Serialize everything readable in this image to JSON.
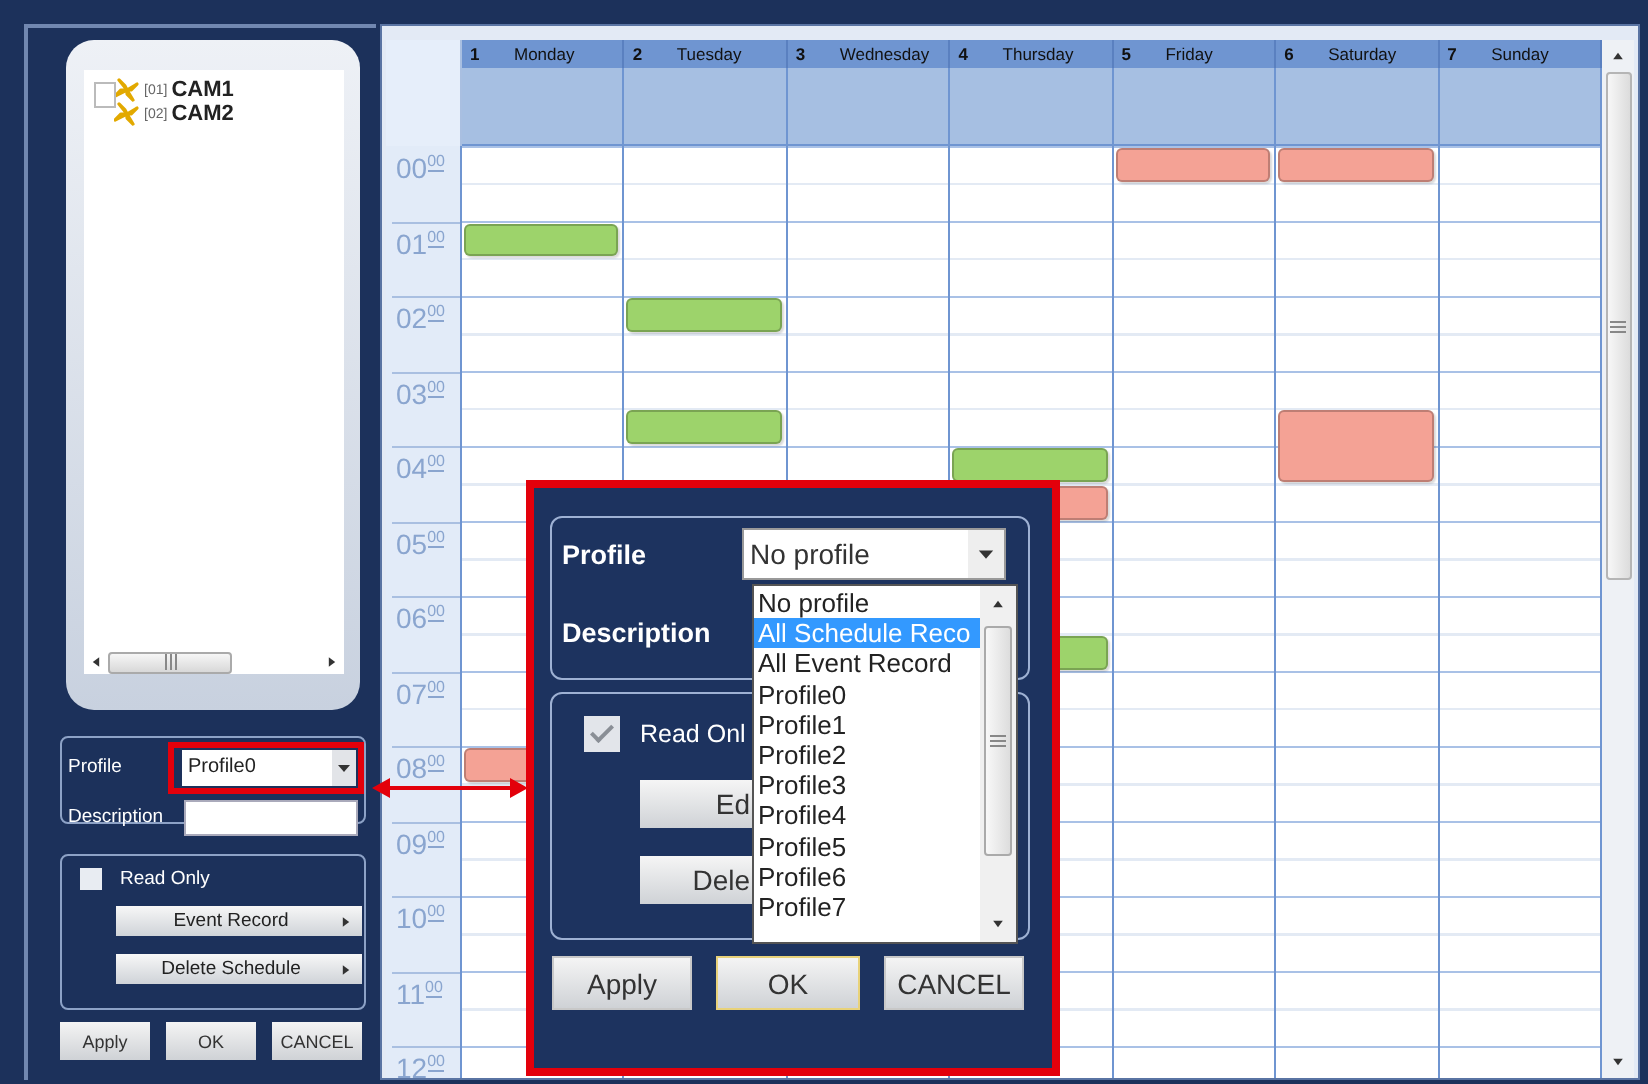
{
  "left_panel": {
    "cameras": {
      "checked": false,
      "items": [
        {
          "number": "[01]",
          "name": "CAM1"
        },
        {
          "number": "[02]",
          "name": "CAM2"
        }
      ]
    },
    "profile_label": "Profile",
    "profile_value": "Profile0",
    "description_label": "Description",
    "read_only": {
      "label": "Read Only",
      "checked": false
    },
    "menu_buttons": [
      "Event Record",
      "Delete Schedule"
    ],
    "buttons": [
      "Apply",
      "OK",
      "CANCEL"
    ]
  },
  "calendar": {
    "hours": [
      "00$^{00}$",
      "01$^{00}$",
      "02$^{00}$",
      "03$^{00}$",
      "04$^{00}$",
      "05$^{00}$",
      "06$^{00}$",
      "07$^{00}$",
      "08$^{00}$",
      "09$^{00}$",
      "10$^{00}$",
      "11$^{00}$",
      "12$^{00}$"
    ],
    "days": [
      {
        "number": "1",
        "name": "Monday",
        "slots": [
          {
            "kind": "empty"
          },
          {
            "kind": "empty"
          },
          {
            "kind": "block",
            "color": "#9dd36b"
          },
          {
            "kind": "empty"
          },
          {
            "kind": "empty"
          },
          {
            "kind": "empty"
          },
          {
            "kind": "empty"
          },
          {
            "kind": "empty"
          },
          {
            "kind": "empty"
          },
          {
            "kind": "empty"
          },
          {
            "kind": "empty"
          },
          {
            "kind": "empty"
          },
          {
            "kind": "empty"
          },
          {
            "kind": "empty"
          },
          {
            "kind": "empty"
          },
          {
            "kind": "empty"
          },
          {
            "kind": "block",
            "color": "#f4a295"
          },
          {
            "kind": "empty"
          },
          {
            "kind": "empty"
          },
          {
            "kind": "empty"
          },
          {
            "kind": "empty"
          },
          {
            "kind": "empty"
          },
          {
            "kind": "empty"
          },
          {
            "kind": "empty"
          },
          {
            "kind": "empty"
          }
        ]
      },
      {
        "number": "2",
        "name": "Tuesday",
        "slots": [
          {
            "kind": "empty"
          },
          {
            "kind": "empty"
          },
          {
            "kind": "empty"
          },
          {
            "kind": "empty"
          },
          {
            "kind": "block",
            "color": "#9dd36b"
          },
          {
            "kind": "empty"
          },
          {
            "kind": "empty"
          },
          {
            "kind": "block",
            "color": "#9dd36b"
          },
          {
            "kind": "empty"
          },
          {
            "kind": "empty"
          },
          {
            "kind": "empty"
          },
          {
            "kind": "empty"
          },
          {
            "kind": "empty"
          },
          {
            "kind": "empty"
          },
          {
            "kind": "empty"
          },
          {
            "kind": "empty"
          },
          {
            "kind": "empty"
          },
          {
            "kind": "empty"
          },
          {
            "kind": "empty"
          },
          {
            "kind": "empty"
          },
          {
            "kind": "empty"
          },
          {
            "kind": "empty"
          },
          {
            "kind": "empty"
          },
          {
            "kind": "empty"
          },
          {
            "kind": "empty"
          }
        ]
      },
      {
        "number": "3",
        "name": "Wednesday",
        "slots": [
          {
            "kind": "empty"
          },
          {
            "kind": "empty"
          },
          {
            "kind": "empty"
          },
          {
            "kind": "empty"
          },
          {
            "kind": "empty"
          },
          {
            "kind": "empty"
          },
          {
            "kind": "empty"
          },
          {
            "kind": "empty"
          },
          {
            "kind": "empty"
          },
          {
            "kind": "empty"
          },
          {
            "kind": "empty"
          },
          {
            "kind": "empty"
          },
          {
            "kind": "empty"
          },
          {
            "kind": "empty"
          },
          {
            "kind": "empty"
          },
          {
            "kind": "empty"
          },
          {
            "kind": "empty"
          },
          {
            "kind": "empty"
          },
          {
            "kind": "empty"
          },
          {
            "kind": "empty"
          },
          {
            "kind": "empty"
          },
          {
            "kind": "empty"
          },
          {
            "kind": "empty"
          },
          {
            "kind": "empty"
          },
          {
            "kind": "empty"
          }
        ]
      },
      {
        "number": "4",
        "name": "Thursday",
        "slots": [
          {
            "kind": "empty"
          },
          {
            "kind": "empty"
          },
          {
            "kind": "empty"
          },
          {
            "kind": "empty"
          },
          {
            "kind": "empty"
          },
          {
            "kind": "empty"
          },
          {
            "kind": "empty"
          },
          {
            "kind": "empty"
          },
          {
            "kind": "block",
            "color": "#9dd36b"
          },
          {
            "kind": "block",
            "color": "#f4a295"
          },
          {
            "kind": "empty"
          },
          {
            "kind": "empty"
          },
          {
            "kind": "empty"
          },
          {
            "kind": "block",
            "color": "#9dd36b"
          },
          {
            "kind": "empty"
          },
          {
            "kind": "empty"
          },
          {
            "kind": "empty"
          },
          {
            "kind": "empty"
          },
          {
            "kind": "empty"
          },
          {
            "kind": "empty"
          },
          {
            "kind": "empty"
          },
          {
            "kind": "empty"
          },
          {
            "kind": "empty"
          },
          {
            "kind": "empty"
          },
          {
            "kind": "empty"
          }
        ]
      },
      {
        "number": "5",
        "name": "Friday",
        "slots": [
          {
            "kind": "block",
            "color": "#f4a295"
          },
          {
            "kind": "empty"
          },
          {
            "kind": "empty"
          },
          {
            "kind": "empty"
          },
          {
            "kind": "empty"
          },
          {
            "kind": "empty"
          },
          {
            "kind": "empty"
          },
          {
            "kind": "empty"
          },
          {
            "kind": "empty"
          },
          {
            "kind": "empty"
          },
          {
            "kind": "empty"
          },
          {
            "kind": "empty"
          },
          {
            "kind": "empty"
          },
          {
            "kind": "empty"
          },
          {
            "kind": "empty"
          },
          {
            "kind": "empty"
          },
          {
            "kind": "empty"
          },
          {
            "kind": "empty"
          },
          {
            "kind": "empty"
          },
          {
            "kind": "empty"
          },
          {
            "kind": "empty"
          },
          {
            "kind": "empty"
          },
          {
            "kind": "empty"
          },
          {
            "kind": "empty"
          },
          {
            "kind": "empty"
          }
        ]
      },
      {
        "number": "6",
        "name": "Saturday",
        "slots": [
          {
            "kind": "block",
            "color": "#f4a295"
          },
          {
            "kind": "empty"
          },
          {
            "kind": "empty"
          },
          {
            "kind": "empty"
          },
          {
            "kind": "empty"
          },
          {
            "kind": "empty"
          },
          {
            "kind": "empty"
          },
          {
            "kind": "block",
            "color": "#f4a295"
          },
          {
            "kind": "block",
            "color": "#f4a295"
          },
          {
            "kind": "empty"
          },
          {
            "kind": "empty"
          },
          {
            "kind": "empty"
          },
          {
            "kind": "empty"
          },
          {
            "kind": "empty"
          },
          {
            "kind": "empty"
          },
          {
            "kind": "empty"
          },
          {
            "kind": "empty"
          },
          {
            "kind": "empty"
          },
          {
            "kind": "empty"
          },
          {
            "kind": "empty"
          },
          {
            "kind": "empty"
          },
          {
            "kind": "empty"
          },
          {
            "kind": "empty"
          },
          {
            "kind": "empty"
          },
          {
            "kind": "empty"
          }
        ]
      },
      {
        "number": "7",
        "name": "Sunday",
        "slots": [
          {
            "kind": "empty"
          },
          {
            "kind": "empty"
          },
          {
            "kind": "empty"
          },
          {
            "kind": "empty"
          },
          {
            "kind": "empty"
          },
          {
            "kind": "empty"
          },
          {
            "kind": "empty"
          },
          {
            "kind": "empty"
          },
          {
            "kind": "empty"
          },
          {
            "kind": "empty"
          },
          {
            "kind": "empty"
          },
          {
            "kind": "empty"
          },
          {
            "kind": "empty"
          },
          {
            "kind": "empty"
          },
          {
            "kind": "empty"
          },
          {
            "kind": "empty"
          },
          {
            "kind": "empty"
          },
          {
            "kind": "empty"
          },
          {
            "kind": "empty"
          },
          {
            "kind": "empty"
          },
          {
            "kind": "empty"
          },
          {
            "kind": "empty"
          },
          {
            "kind": "empty"
          },
          {
            "kind": "empty"
          },
          {
            "kind": "empty"
          }
        ]
      }
    ]
  },
  "zoom_callout": {
    "profile_label": "Profile",
    "profile_value": "No profile",
    "description_label": "Description",
    "read_only": {
      "label": "Read Onl",
      "checked": true
    },
    "menu_buttons": [
      "Ed",
      "Dele"
    ],
    "dropdown_options": [
      {
        "label": "No profile",
        "selected": false
      },
      {
        "label": "All Schedule Reco",
        "selected": true
      },
      {
        "label": "All Event Record",
        "selected": false
      },
      {
        "label": "Profile0",
        "selected": false
      },
      {
        "label": "Profile1",
        "selected": false
      },
      {
        "label": "Profile2",
        "selected": false
      },
      {
        "label": "Profile3",
        "selected": false
      },
      {
        "label": "Profile4",
        "selected": false
      },
      {
        "label": "Profile5",
        "selected": false
      },
      {
        "label": "Profile6",
        "selected": false
      },
      {
        "label": "Profile7",
        "selected": false
      }
    ],
    "buttons": [
      "Apply",
      "OK",
      "CANCEL"
    ]
  }
}
